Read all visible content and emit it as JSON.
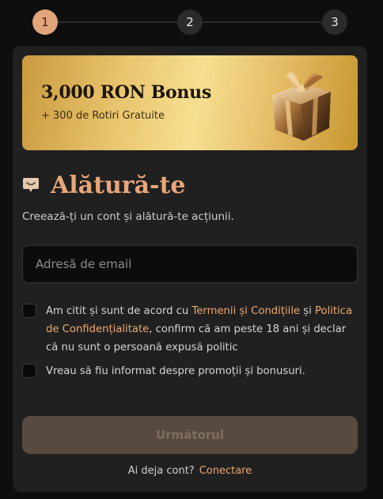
{
  "stepper": {
    "steps": [
      "1",
      "2",
      "3"
    ],
    "active": 1
  },
  "banner": {
    "title": "3,000 RON Bonus",
    "subtitle": "+ 300 de Rotiri Gratuite"
  },
  "form": {
    "heading": "Alătură-te",
    "subtitle": "Creează-ți un cont și alătură-te acțiunii.",
    "email_placeholder": "Adresă de email",
    "terms": {
      "prefix": "Am citit și sunt de acord cu ",
      "terms_link": "Termenii și Condițiile",
      "and": " și ",
      "privacy_link": "Politica de Confidențialitate",
      "suffix": ", confirm că am peste 18 ani și declar că nu sunt o persoană expusă politic"
    },
    "promo_label": "Vreau să fiu informat despre promoții și bonusuri.",
    "next_label": "Următorul",
    "login_prompt": "Ai deja cont?",
    "login_link": "Conectare"
  },
  "colors": {
    "accent": "#e8a679",
    "link": "#eda970",
    "step_active": "#e2a57b",
    "button_disabled": "#574a3e"
  },
  "icons": {
    "heading": "chat-bubble-icon",
    "banner": "gift-box-icon"
  }
}
